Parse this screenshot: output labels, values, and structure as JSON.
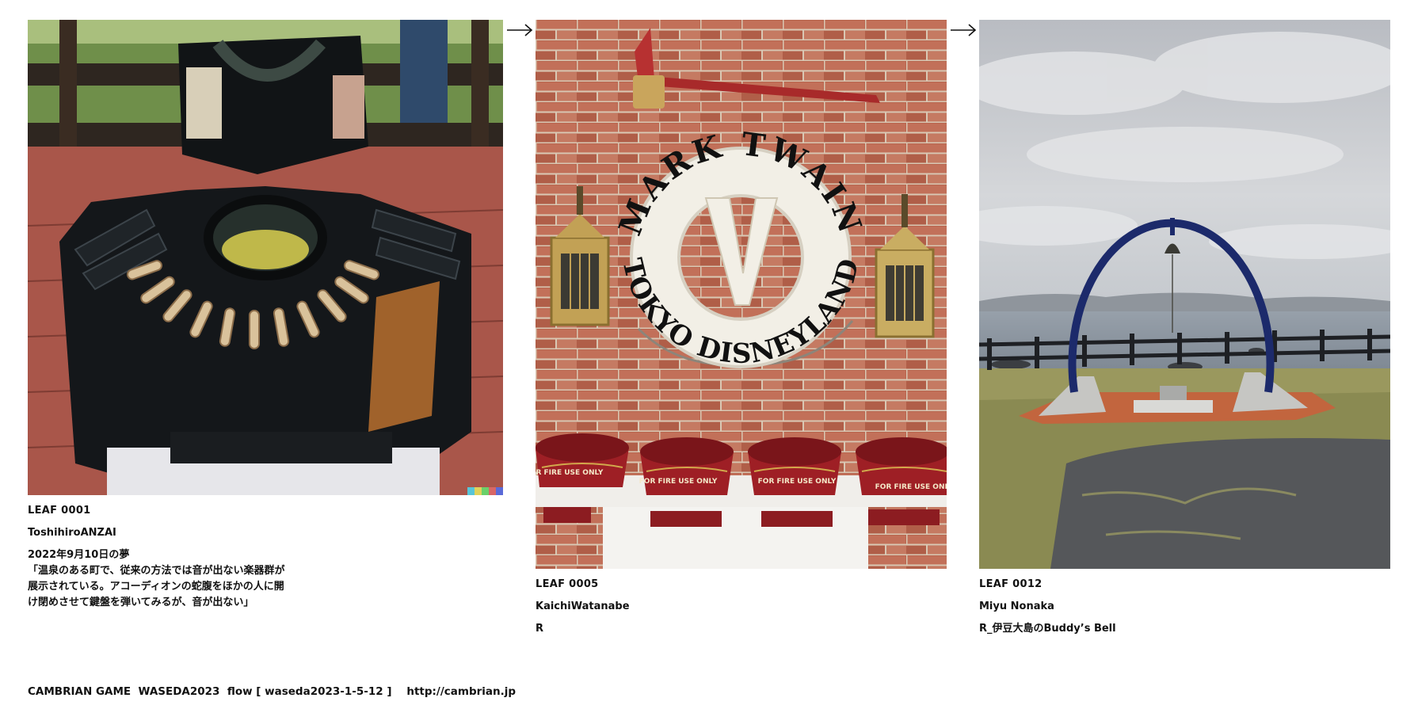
{
  "leaves": [
    {
      "code": "LEAF 0001",
      "author": "ToshihiroANZAI",
      "title": "2022年9月10日の夢",
      "description": "「温泉のある町で、従来の方法では音が出ない楽器群が\n展示されている。アコーディオンの蛇腹をほかの人に開\nけ閉めさせて鍵盤を弾いてみるが、音が出ない」",
      "image": "accordion-instrument-photo"
    },
    {
      "code": "LEAF 0005",
      "author": "KaichiWatanabe",
      "title": "R",
      "image": "mark-twain-lifebuoy-photo",
      "lifebuoy_top_text": "MARK TWAIN",
      "lifebuoy_bottom_text": "TOKYO DISNEYLAND",
      "lifebuoy_center_text": "V",
      "bucket_text": "FOR FIRE USE ONLY"
    },
    {
      "code": "LEAF 0012",
      "author": "Miyu Nonaka",
      "title": "R_伊豆大島のBuddy’s Bell",
      "image": "buddys-bell-photo"
    }
  ],
  "footer": {
    "text": "CAMBRIAN GAME  WASEDA2023  flow [ waseda2023-1-5-12 ]    http://cambrian.jp"
  },
  "colors": {
    "brick": "#b8664f",
    "lifebuoy": "#f2efe6",
    "bucket_red": "#9e1f25",
    "bell_ring": "#1c2a6b",
    "sky": "#c9ccd1",
    "sea": "#8e98a3",
    "grass": "#8a8a52"
  }
}
